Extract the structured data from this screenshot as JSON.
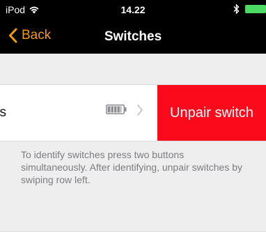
{
  "status_bar": {
    "carrier": "iPod",
    "time": "14.22",
    "wifi_icon": "wifi-icon",
    "bluetooth_icon": "bluetooth-icon",
    "battery_icon": "battery-icon"
  },
  "nav": {
    "back_label": "Back",
    "title": "Switches"
  },
  "switch_row": {
    "label": "ss",
    "battery_level": 0.9,
    "chevron_icon": "chevron-right-icon",
    "unpair_label": "Unpair switch"
  },
  "footer": {
    "text": "To identify switches press two buttons simultaneously. After identifying, unpair switches by swiping row left."
  },
  "colors": {
    "accent": "#f39a12",
    "destructive": "#fb0a1c",
    "background": "#eeeeef",
    "bars": "#000000"
  }
}
